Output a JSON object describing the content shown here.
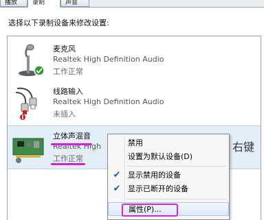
{
  "tabs": [
    {
      "label": "播放"
    },
    {
      "label": "录制"
    },
    {
      "label": "声音"
    }
  ],
  "instruction": "选择以下录制设备来修改设置:",
  "devices": [
    {
      "name": "麦克风",
      "driver": "Realtek High Definition Audio",
      "status": "工作正常",
      "icon": "microphone-icon",
      "badge": "check-badge-icon"
    },
    {
      "name": "线路输入",
      "driver": "Realtek High Definition Audio",
      "status": "未插入",
      "icon": "line-in-cable-icon",
      "badge": "unplugged-badge-icon"
    },
    {
      "name": "立体声混音",
      "driver": "Realtek High",
      "status": "工作正常",
      "icon": "sound-card-icon",
      "badge": "disabled-badge-icon"
    }
  ],
  "annotation": "右键",
  "context_menu": {
    "items": [
      {
        "label": "禁用",
        "checked": false
      },
      {
        "label": "设置为默认设备(D)",
        "checked": false
      },
      {
        "label": "显示禁用的设备",
        "checked": true
      },
      {
        "label": "显示已断开的设备",
        "checked": true
      },
      {
        "label": "属性(P)...",
        "checked": false
      }
    ],
    "check_glyph": "✔"
  },
  "colors": {
    "accent_highlight": "#d61fd6",
    "selection_bg": "#e4eef9",
    "check_color": "#1a56b0"
  }
}
